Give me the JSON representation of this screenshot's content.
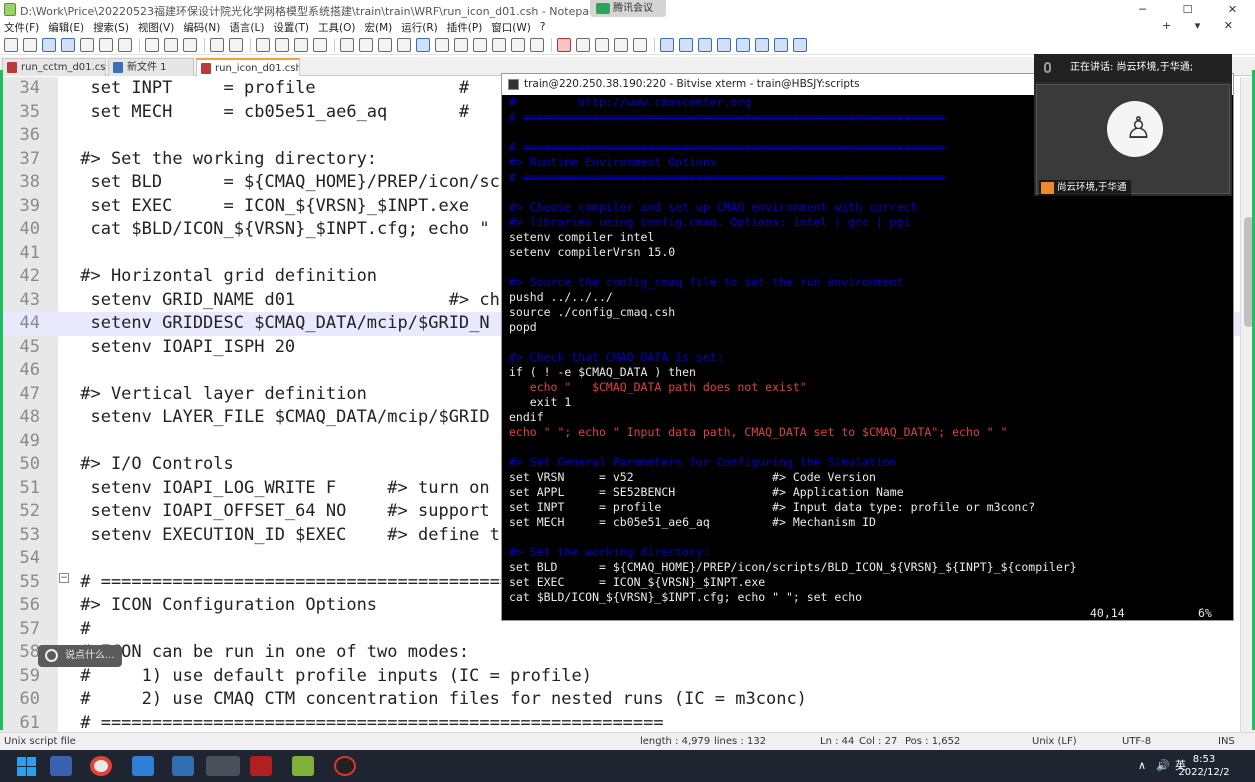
{
  "window": {
    "title": "D:\\Work\\Price\\20220523福建环保设计院光化学网格模型系统搭建\\train\\train\\WRF\\run_icon_d01.csh - Notepad++",
    "controls": [
      "─",
      "☐",
      "✕"
    ],
    "meeting_badge": "腾讯会议"
  },
  "menu": {
    "items": [
      "文件(F)",
      "编辑(E)",
      "搜索(S)",
      "视图(V)",
      "编码(N)",
      "语言(L)",
      "设置(T)",
      "工具(O)",
      "宏(M)",
      "运行(R)",
      "插件(P)",
      "窗口(W)",
      "?"
    ],
    "right": "+ ▾ ✕"
  },
  "tabs": [
    {
      "label": "run_cctm_d01.csh",
      "active": false
    },
    {
      "label": "新文件 1",
      "active": false
    },
    {
      "label": "run_icon_d01.csh",
      "active": true
    }
  ],
  "editor": {
    "current_line": "44",
    "lines": [
      {
        "n": "34",
        "t": "  set INPT     = profile              #"
      },
      {
        "n": "35",
        "t": "  set MECH     = cb05e51_ae6_aq       #"
      },
      {
        "n": "36",
        "t": ""
      },
      {
        "n": "37",
        "t": " #> Set the working directory:"
      },
      {
        "n": "38",
        "t": "  set BLD      = ${CMAQ_HOME}/PREP/icon/sc"
      },
      {
        "n": "39",
        "t": "  set EXEC     = ICON_${VRSN}_$INPT.exe"
      },
      {
        "n": "40",
        "t": "  cat $BLD/ICON_${VRSN}_$INPT.cfg; echo \""
      },
      {
        "n": "41",
        "t": ""
      },
      {
        "n": "42",
        "t": " #> Horizontal grid definition"
      },
      {
        "n": "43",
        "t": "  setenv GRID_NAME d01               #> ch"
      },
      {
        "n": "44",
        "t": "  setenv GRIDDESC $CMAQ_DATA/mcip/$GRID_N"
      },
      {
        "n": "45",
        "t": "  setenv IOAPI_ISPH 20"
      },
      {
        "n": "46",
        "t": ""
      },
      {
        "n": "47",
        "t": " #> Vertical layer definition"
      },
      {
        "n": "48",
        "t": "  setenv LAYER_FILE $CMAQ_DATA/mcip/$GRID"
      },
      {
        "n": "49",
        "t": ""
      },
      {
        "n": "50",
        "t": " #> I/O Controls"
      },
      {
        "n": "51",
        "t": "  setenv IOAPI_LOG_WRITE F     #> turn on"
      },
      {
        "n": "52",
        "t": "  setenv IOAPI_OFFSET_64 NO    #> support"
      },
      {
        "n": "53",
        "t": "  setenv EXECUTION_ID $EXEC    #> define t"
      },
      {
        "n": "54",
        "t": ""
      },
      {
        "n": "55",
        "t": " # ======================================================="
      },
      {
        "n": "56",
        "t": " #> ICON Configuration Options"
      },
      {
        "n": "57",
        "t": " #"
      },
      {
        "n": "58",
        "t": " # ICON can be run in one of two modes:"
      },
      {
        "n": "59",
        "t": " #     1) use default profile inputs (IC = profile)"
      },
      {
        "n": "60",
        "t": " #     2) use CMAQ CTM concentration files for nested runs (IC = m3conc)"
      },
      {
        "n": "61",
        "t": " # ======================================================="
      }
    ]
  },
  "status": {
    "lang": "Unix script file",
    "length": "length : 4,979",
    "lines": "lines : 132",
    "ln": "Ln : 44",
    "col": "Col : 27",
    "pos": "Pos : 1,652",
    "eol": "Unix (LF)",
    "enc": "UTF-8",
    "mode": "INS"
  },
  "chat": {
    "placeholder": "说点什么..."
  },
  "xterm": {
    "title": "train@220.250.38.190:220 - Bitvise xterm - train@HBSJY:scripts",
    "cursor_pos": "40,14",
    "percent": "6%",
    "lines": [
      {
        "t": "#         http://www.cmascenter.org",
        "c": "#0000cc"
      },
      {
        "t": "# =============================================================",
        "c": "#0000cc"
      },
      {
        "t": "",
        "c": "#eaeaea"
      },
      {
        "t": "# =============================================================",
        "c": "#0000cc"
      },
      {
        "t": "#> Runtime Environment Options",
        "c": "#0000cc"
      },
      {
        "t": "# =============================================================",
        "c": "#0000cc"
      },
      {
        "t": "",
        "c": "#eaeaea"
      },
      {
        "t": "#> Choose compiler and set up CMAQ environment with correct",
        "c": "#0000cc"
      },
      {
        "t": "#> libraries using config.cmaq. Options: intel | gcc | pgi",
        "c": "#0000cc"
      },
      {
        "t": "setenv compiler intel",
        "c": "#eaeaea"
      },
      {
        "t": "setenv compilerVrsn 15.0",
        "c": "#eaeaea"
      },
      {
        "t": "",
        "c": "#eaeaea"
      },
      {
        "t": "#> Source the config_cmaq file to set the run environment",
        "c": "#0000cc"
      },
      {
        "t": "pushd ../../../",
        "c": "#eaeaea"
      },
      {
        "t": "source ./config_cmaq.csh",
        "c": "#eaeaea"
      },
      {
        "t": "popd",
        "c": "#eaeaea"
      },
      {
        "t": "",
        "c": "#eaeaea"
      },
      {
        "t": "#> Check that CMAQ_DATA is set:",
        "c": "#0000cc"
      },
      {
        "t": "if ( ! -e $CMAQ_DATA ) then",
        "c": "#eaeaea"
      },
      {
        "t": "   echo \"   $CMAQ_DATA path does not exist\"",
        "c": "#e04040"
      },
      {
        "t": "   exit 1",
        "c": "#eaeaea"
      },
      {
        "t": "endif",
        "c": "#eaeaea"
      },
      {
        "t": "echo \" \"; echo \" Input data path, CMAQ_DATA set to $CMAQ_DATA\"; echo \" \"",
        "c": "#e04040"
      },
      {
        "t": "",
        "c": "#eaeaea"
      },
      {
        "t": "#> Set General Parameters for Configuring the Simulation",
        "c": "#0000cc"
      },
      {
        "t": "set VRSN     = v52                    #> Code Version",
        "c": "#eaeaea"
      },
      {
        "t": "set APPL     = SE52BENCH              #> Application Name",
        "c": "#eaeaea"
      },
      {
        "t": "set INPT     = profile                #> Input data type: profile or m3conc?",
        "c": "#eaeaea"
      },
      {
        "t": "set MECH     = cb05e51_ae6_aq         #> Mechanism ID",
        "c": "#eaeaea"
      },
      {
        "t": "",
        "c": "#eaeaea"
      },
      {
        "t": "#> Set the working directory:",
        "c": "#0000cc"
      },
      {
        "t": "set BLD      = ${CMAQ_HOME}/PREP/icon/scripts/BLD_ICON_${VRSN}_${INPT}_${compiler}",
        "c": "#eaeaea"
      },
      {
        "t": "set EXEC     = ICON_${VRSN}_$INPT.exe",
        "c": "#eaeaea"
      },
      {
        "t": "cat $BLD/ICON_${VRSN}_$INPT.cfg; echo \" \"; set echo",
        "c": "#eaeaea"
      }
    ]
  },
  "meeting": {
    "speaking": "正在讲话: 尚云环境,于华通;",
    "participant": "尚云环境,于华通"
  },
  "taskbar": {
    "ime": "英",
    "time": "8:53",
    "date": "2022/12/2"
  }
}
